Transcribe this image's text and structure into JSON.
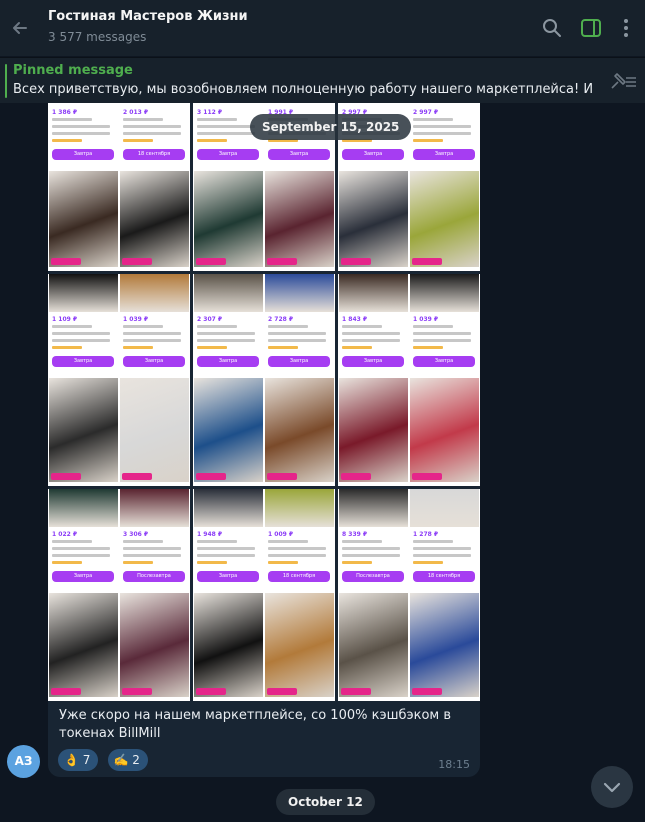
{
  "header": {
    "title": "Гостиная Мастеров Жизни",
    "subtitle": "3 577 messages"
  },
  "pinned": {
    "label": "Pinned message",
    "text": "Всех приветствую, мы возобновляем полноценную работу нашего маркетплейса!  И уже ..."
  },
  "chat": {
    "date_top": "September 15, 2025",
    "date_bottom": "October 12",
    "message": {
      "author_initials": "АЗ",
      "caption": "Уже скоро на нашем маркетплейсе, со 100% кэшбэком в токенах BillMill",
      "time": "18:15",
      "reactions": [
        {
          "emoji": "👌",
          "count": "7"
        },
        {
          "emoji": "✍️",
          "count": "2"
        }
      ],
      "image_tiles": [
        {
          "prices": [
            "1 386 ₽",
            "2 013 ₽"
          ],
          "buttons": [
            "Завтра",
            "18 сентября"
          ]
        },
        {
          "prices": [
            "3 112 ₽",
            "1 991 ₽"
          ],
          "buttons": [
            "Завтра",
            "Завтра"
          ]
        },
        {
          "prices": [
            "2 997 ₽",
            "2 997 ₽"
          ],
          "buttons": [
            "Завтра",
            "Завтра"
          ]
        },
        {
          "prices": [
            "1 109 ₽",
            "1 039 ₽"
          ],
          "buttons": [
            "Завтра",
            "Завтра"
          ]
        },
        {
          "prices": [
            "2 307 ₽",
            "2 728 ₽"
          ],
          "buttons": [
            "Завтра",
            "Завтра"
          ]
        },
        {
          "prices": [
            "1 843 ₽",
            "1 039 ₽"
          ],
          "buttons": [
            "Завтра",
            "Завтра"
          ]
        },
        {
          "prices": [
            "1 022 ₽",
            "3 306 ₽"
          ],
          "buttons": [
            "Завтра",
            "Послезавтра"
          ]
        },
        {
          "prices": [
            "1 948 ₽",
            "1 009 ₽"
          ],
          "buttons": [
            "Завтра",
            "18 сентября"
          ]
        },
        {
          "prices": [
            "8 339 ₽",
            "1 278 ₽"
          ],
          "buttons": [
            "Послезавтра",
            "18 сентября"
          ]
        }
      ]
    }
  },
  "colors": {
    "bg": "#0e1621",
    "header": "#17212b",
    "bubble": "#182533",
    "accent_green": "#4fae4e",
    "avatar": "#5ba2e0",
    "purple": "#a63df2"
  },
  "icons": [
    "back-arrow-icon",
    "search-icon",
    "sidebar-toggle-icon",
    "more-vertical-icon",
    "unpin-icon",
    "chevron-down-icon"
  ]
}
